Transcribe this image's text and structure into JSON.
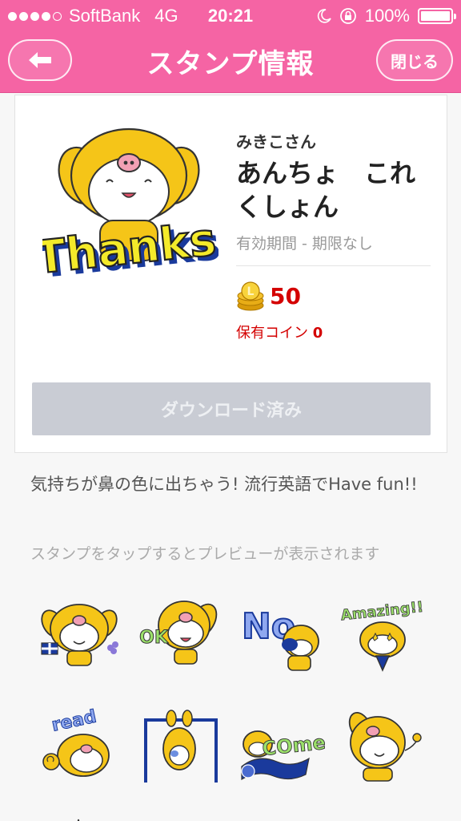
{
  "status_bar": {
    "carrier": "SoftBank",
    "network": "4G",
    "time": "20:21",
    "battery": "100%",
    "battery_level": 1.0,
    "signal_bars": 4,
    "icons": [
      "moon-icon",
      "rotation-lock-icon",
      "battery-icon"
    ]
  },
  "nav": {
    "title": "スタンプ情報",
    "back_icon": "arrow-left-icon",
    "close_label": "閉じる"
  },
  "pack": {
    "author": "みきこさん",
    "title": "あんちょ　これくしょん",
    "validity": "有効期間 - 期限なし",
    "price": "50",
    "coin_icon": "line-coin-icon",
    "owned_label": "保有コイン",
    "owned_value": "0",
    "main_sticker_text": "Thanks",
    "download_label": "ダウンロード済み"
  },
  "description": "気持ちが鼻の色に出ちゃう! 流行英語でHave fun!!",
  "preview_hint": "スタンプをタップするとプレビューが表示されます",
  "stickers": [
    {
      "name": "sticker-flags",
      "text": ""
    },
    {
      "name": "sticker-ok",
      "text": "OK"
    },
    {
      "name": "sticker-no",
      "text": "No"
    },
    {
      "name": "sticker-amazing",
      "text": "Amazing!!"
    },
    {
      "name": "sticker-read",
      "text": "read"
    },
    {
      "name": "sticker-bar",
      "text": ""
    },
    {
      "name": "sticker-come",
      "text": "COme"
    },
    {
      "name": "sticker-wave",
      "text": ""
    }
  ],
  "colors": {
    "brand_pink": "#f564a4",
    "price_red": "#d40000",
    "dog_yellow": "#f5c518",
    "nose_pink": "#f2a0b4",
    "disabled_button": "#c9ccd4"
  }
}
